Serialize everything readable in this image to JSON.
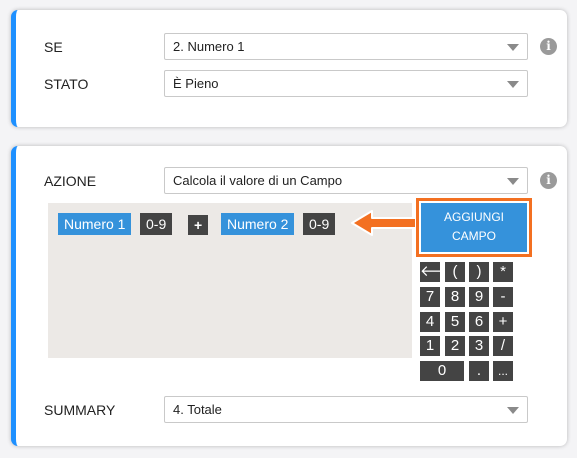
{
  "condition": {
    "se_label": "SE",
    "se_value": "2. Numero 1",
    "stato_label": "STATO",
    "stato_value": "È Pieno",
    "info_icon": "i"
  },
  "action": {
    "azione_label": "AZIONE",
    "azione_value": "Calcola il valore di un Campo",
    "info_icon": "i",
    "formula_tokens": [
      "Numero 1",
      "0-9",
      "+",
      "Numero 2",
      "0-9"
    ],
    "add_field_line1": "AGGIUNGI",
    "add_field_line2": "CAMPO",
    "keypad": {
      "row1": [
        "🡐",
        "(",
        ")",
        "*"
      ],
      "row2": [
        "7",
        "8",
        "9",
        "-"
      ],
      "row3": [
        "4",
        "5",
        "6",
        "+"
      ],
      "row4": [
        "1",
        "2",
        "3",
        "/"
      ],
      "row5": [
        "0",
        ".",
        "..."
      ]
    },
    "summary_label": "SUMMARY",
    "summary_value": "4. Totale"
  },
  "colors": {
    "accent": "#1e90ff",
    "token_blue": "#3592db",
    "highlight": "#f37021"
  }
}
